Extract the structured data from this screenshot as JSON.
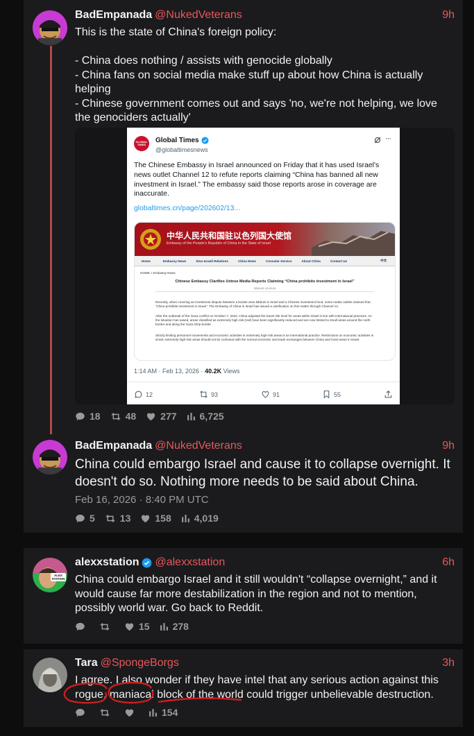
{
  "colors": {
    "accent": "#e8575c",
    "thread_line": "#b84748",
    "annotation": "#cc1f1f",
    "verified": "#1d9bf0"
  },
  "post1": {
    "author": "BadEmpanada",
    "handle": "@NukedVeterans",
    "time": "9h",
    "lines": [
      "This is the state of China's foreign policy:",
      "- China does nothing / assists with genocide globally",
      "- China fans on social media make stuff up about how China is actually helping",
      "- Chinese government comes out and says 'no, we're not helping, we love the genociders actually'"
    ],
    "embed": {
      "account_name": "Global Times",
      "account_handle": "@globaltimesnews",
      "logo_text": "GLOBAL TIMES",
      "body": "The Chinese Embassy in Israel announced on Friday that it has used Israel's news outlet Channel 12 to refute reports claiming “China has banned all new investment in Israel.” The embassy said those reports arose in coverage are inaccurate.",
      "link": "globaltimes.cn/page/202602/13...",
      "website": {
        "title_cn": "中华人民共和国驻以色列国大使馆",
        "title_en": "Embassy of the People's Republic of China in the State of Israel",
        "nav": [
          "Home",
          "Embassy News",
          "Sino-Israeli Relations",
          "China News",
          "Consular Service",
          "About China",
          "Contact Us",
          "中文"
        ],
        "breadcrumb": "HOME > Embassy News",
        "headline": "Chinese Embassy Clarifies Untrue Media Reports Claiming “China prohibits investment in Israel”",
        "date": "2026-02-13 00:24",
        "paragraphs": [
          "Recently, when covering an investment dispute between a border-area kibbutz in Israel and a Chinese investment fund, some media outlets claimed that “China prohibits investment in Israel.” The Embassy of China in Israel has issued a clarification on this matter through Channel 12.",
          "After the outbreak of the Gaza conflict on October 7, 2023, China adjusted the travel risk level for areas within Israel in line with international practices. As the situation has eased, areas classified as extremely high risk (red) have been significantly reduced and are now limited to small areas around the north border and along the Gaza Strip border.",
          "Strictly limiting personnel movements and economic activities in extremely high-risk areas is an international practice. Restrictions on economic activities in small, extremely high-risk areas should not be confused with the normal economic and trade exchanges between China and most areas in Israel."
        ]
      },
      "timestamp": "1:14 AM · Feb 13, 2026 · ",
      "views_count": "40.2K",
      "views_label": " Views",
      "actions": {
        "reply": "12",
        "repost": "93",
        "like": "91",
        "bookmark": "55"
      }
    },
    "stats": {
      "reply": "18",
      "repost": "48",
      "like": "277",
      "views": "6,725"
    }
  },
  "post2": {
    "author": "BadEmpanada",
    "handle": "@NukedVeterans",
    "time": "9h",
    "text": "China could embargo Israel and cause it to collapse overnight. It doesn't do so. Nothing more needs to be said about China.",
    "datetime": "Feb 16, 2026 · 8:40 PM UTC",
    "stats": {
      "reply": "5",
      "repost": "13",
      "like": "158",
      "views": "4,019"
    }
  },
  "post3": {
    "author": "alexxstation",
    "handle": "@alexxstation",
    "avatar_text": "ALEX STATION",
    "time": "6h",
    "text": "China could embargo Israel and it still wouldn't “collapse overnight,” and it would cause far more destabilization in the region and not to mention, possibly world war. Go back to Reddit.",
    "stats": {
      "reply": "",
      "repost": "",
      "like": "15",
      "views": "278"
    }
  },
  "post4": {
    "author": "Tara",
    "handle": "@SpongeBorgs",
    "time": "3h",
    "text_start": "I agree. I also wonder if they have intel that any serious action against this ",
    "word_rogue": "rogue",
    "text_comma": ", ",
    "word_maniacal": "maniacal",
    "text_space": " ",
    "phrase_block": "block of the world",
    "text_end": " could trigger unbelievable destruction.",
    "stats": {
      "reply": "",
      "repost": "",
      "like": "",
      "views": "154"
    }
  }
}
